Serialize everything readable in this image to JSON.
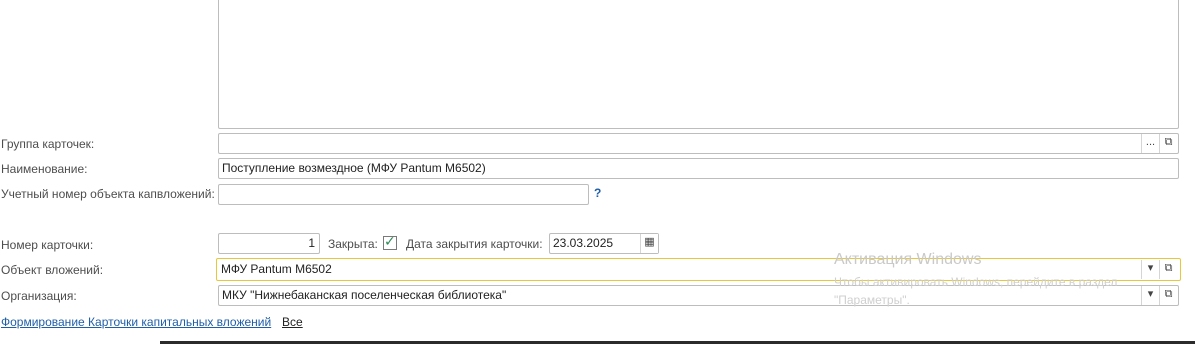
{
  "form": {
    "labels": {
      "card_group": "Группа карточек:",
      "name": "Наименование:",
      "account_number": "Учетный номер объекта капвложений:",
      "card_number": "Номер карточки:",
      "closed": "Закрыта:",
      "close_date": "Дата закрытия карточки:",
      "investment_object": "Объект вложений:",
      "organization": "Организация:"
    },
    "values": {
      "card_group": "",
      "name": "Поступление возмездное (МФУ Pantum M6502)",
      "account_number": "",
      "card_number": "1",
      "closed": true,
      "close_date": "23.03.2025",
      "investment_object": "МФУ Pantum M6502",
      "organization": "МКУ \"Нижнебаканская поселенческая библиотека\""
    },
    "help_mark": "?",
    "ellipsis": "...",
    "dropdown_glyph": "▾",
    "open_glyph": "⧉",
    "calendar_glyph": "▦",
    "check_glyph": "✓"
  },
  "footer": {
    "report_link": "Формирование Карточки капитальных вложений",
    "all_link": "Все"
  },
  "watermark": {
    "title": "Активация Windows",
    "line1": "Чтобы активировать Windows, перейдите в раздел",
    "line2": "\"Параметры\"."
  },
  "colors": {
    "focus_border": "#e6c83c",
    "link": "#1f5fa8",
    "checkmark": "#2e8b57",
    "help": "#1f5fa8"
  }
}
